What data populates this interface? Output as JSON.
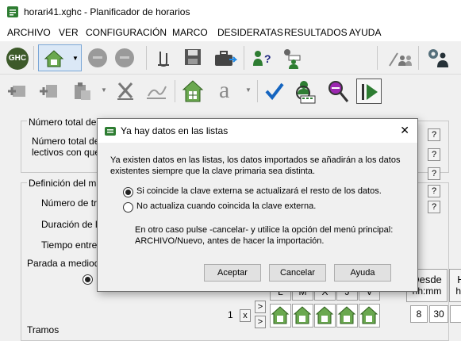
{
  "window": {
    "title": "horari41.xghc - Planificador de horarios"
  },
  "menu": [
    "ARCHIVO",
    "VER",
    "CONFIGURACIÓN",
    "MARCO",
    "DESIDERATAS",
    "RESULTADOS",
    "AYUDA"
  ],
  "toolbar": {
    "ghc_label": "GHC",
    "font_label": "a"
  },
  "background": {
    "total_label_1": "Número total de ac",
    "total_label_2": "Número total de c",
    "total_label_3": "lectivos con que",
    "def_label": "Definición del marc",
    "tramos_label": "Número de tra",
    "duracion_label": "Duración de lo",
    "tiempo_label": "Tiempo entre t",
    "parada_label": "Parada a mediodí",
    "tramos_bottom_label": "Tramos",
    "help_btn": "?",
    "days": [
      "L",
      "M",
      "X",
      "J",
      "V"
    ],
    "desde_header": "Desde",
    "desde_sub": "hh:mm",
    "h_header": "H",
    "h_sub": "hh",
    "row_number": "1",
    "row_x": "x",
    "row_arrow": ">",
    "hour_cells": [
      "8",
      "30"
    ]
  },
  "dialog": {
    "title": "Ya hay datos en las listas",
    "message_1": "Ya existen datos en las listas, los datos importados se añadirán a los datos",
    "message_2": "existentes siempre que la clave primaria sea distinta.",
    "option_1": "Si coincide la clave externa se actualizará el resto de los datos.",
    "option_2": "No actualiza cuando coincida la clave externa.",
    "note_1": "En otro caso pulse -cancelar- y utilice la opción del menú principal:",
    "note_2": "ARCHIVO/Nuevo, antes de hacer la importación.",
    "buttons": {
      "accept": "Aceptar",
      "cancel": "Cancelar",
      "help": "Ayuda"
    },
    "close": "✕"
  }
}
